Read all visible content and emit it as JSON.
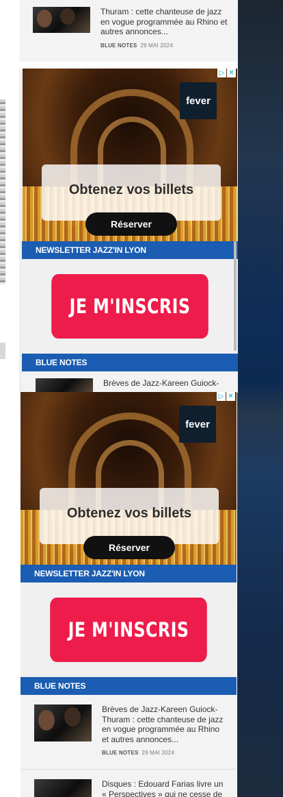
{
  "top_news": {
    "text": "Thuram : cette chanteuse de jazz en vogue programmée au Rhino et autres annonces...",
    "category": "BLUE NOTES",
    "date": "29 MAI 2024"
  },
  "ad_1": {
    "brand": "fever",
    "headline": "Obtenez vos billets",
    "cta": "Réserver",
    "adchoice_info": "▷",
    "adchoice_close": "✕"
  },
  "newsletter_1": {
    "title": "NEWSLETTER JAZZ'IN LYON",
    "button": "JE M'INSCRIS"
  },
  "blue_notes_1": {
    "title": "BLUE NOTES",
    "teaser": "Brèves de Jazz-Kareen Guiock-"
  },
  "ad_2": {
    "brand": "fever",
    "headline": "Obtenez vos billets",
    "cta": "Réserver",
    "adchoice_info": "▷",
    "adchoice_close": "✕"
  },
  "newsletter_2": {
    "title": "NEWSLETTER JAZZ'IN LYON",
    "button": "JE M'INSCRIS"
  },
  "blue_notes_2": {
    "title": "BLUE NOTES",
    "items": [
      {
        "text": "Brèves de Jazz-Kareen Guiock-Thuram : cette chanteuse de jazz en vogue programmée au Rhino et autres annonces...",
        "category": "BLUE NOTES",
        "date": "29 MAI 2024"
      },
      {
        "text": "Disques : Edouard Farias livre un « Perspectives » qui ne cesse de"
      }
    ]
  },
  "colors": {
    "section_blue": "#1b5db2",
    "cta_red": "#ee1c4a"
  }
}
